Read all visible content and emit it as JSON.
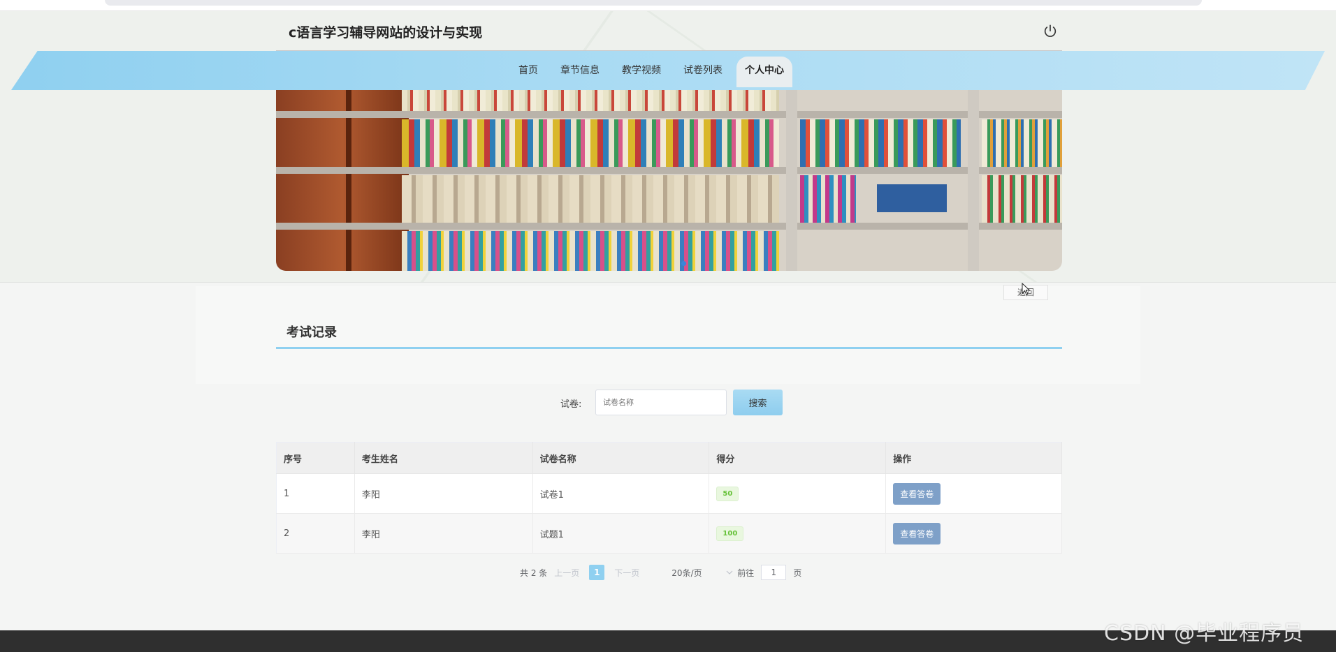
{
  "site": {
    "title": "c语言学习辅导网站的设计与实现"
  },
  "nav": {
    "items": [
      {
        "label": "首页"
      },
      {
        "label": "章节信息"
      },
      {
        "label": "教学视频"
      },
      {
        "label": "试卷列表"
      },
      {
        "label": "个人中心",
        "active": true
      }
    ]
  },
  "back_button": {
    "label": "返回"
  },
  "section": {
    "title": "考试记录"
  },
  "search": {
    "label": "试卷:",
    "placeholder": "试卷名称",
    "button_label": "搜索"
  },
  "table": {
    "headers": [
      "序号",
      "考生姓名",
      "试卷名称",
      "得分",
      "操作"
    ],
    "rows": [
      {
        "index": "1",
        "name": "李阳",
        "paper": "试卷1",
        "score": "50",
        "action": "查看答卷"
      },
      {
        "index": "2",
        "name": "李阳",
        "paper": "试题1",
        "score": "100",
        "action": "查看答卷"
      }
    ]
  },
  "pagination": {
    "total_text": "共 2 条",
    "prev_label": "上一页",
    "current_page": "1",
    "next_label": "下一页",
    "page_size": "20条/页",
    "goto_label": "前往",
    "goto_value": "1",
    "page_suffix": "页"
  },
  "watermark": {
    "text": "CSDN @毕业程序员"
  },
  "colors": {
    "accent": "#8fd0f0",
    "view_button": "#7ea0c8",
    "score_text": "#67c23a",
    "footer": "#2f2f2f"
  },
  "icons": {
    "power": "power-icon"
  }
}
